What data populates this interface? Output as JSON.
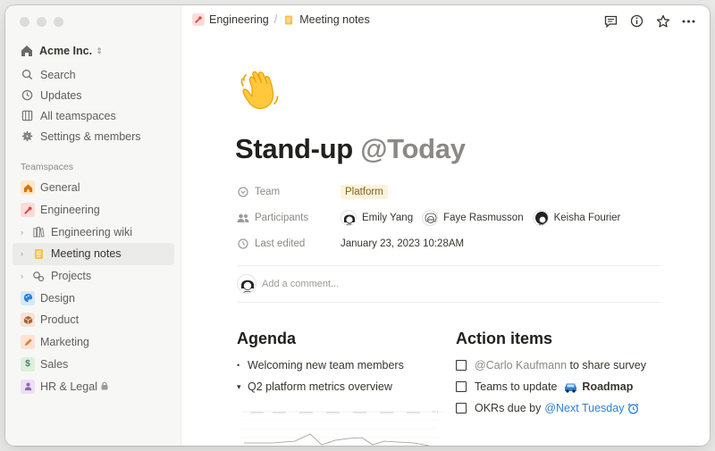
{
  "sidebar": {
    "workspace": "Acme Inc.",
    "workspace_chevron": "⌃⌄",
    "nav": [
      {
        "label": "Search",
        "icon": "search-icon"
      },
      {
        "label": "Updates",
        "icon": "clock-icon"
      },
      {
        "label": "All teamspaces",
        "icon": "grid-icon"
      },
      {
        "label": "Settings & members",
        "icon": "gear-icon"
      }
    ],
    "section_label": "Teamspaces",
    "teamspaces": [
      {
        "label": "General",
        "icon": "house-icon",
        "badge": "#fde8c8"
      },
      {
        "label": "Engineering",
        "icon": "wrench-icon",
        "badge": "#fbdcd9"
      },
      {
        "label": "Engineering wiki",
        "icon": "books-icon",
        "sub": true
      },
      {
        "label": "Meeting notes",
        "icon": "notepad-icon",
        "sub": true,
        "active": true
      },
      {
        "label": "Projects",
        "icon": "gears-icon",
        "sub": true
      },
      {
        "label": "Design",
        "icon": "palette-icon",
        "badge": "#d7e8f7"
      },
      {
        "label": "Product",
        "icon": "box-icon",
        "badge": "#f4e3d6"
      },
      {
        "label": "Marketing",
        "icon": "pen-icon",
        "badge": "#fde3d3"
      },
      {
        "label": "Sales",
        "icon": "dollar-icon",
        "badge": "#dcefdc"
      },
      {
        "label": "HR & Legal",
        "icon": "person-icon",
        "badge": "#ecdff3",
        "locked": true
      }
    ]
  },
  "topbar": {
    "breadcrumb": [
      "Engineering",
      "Meeting notes"
    ],
    "separator": "/"
  },
  "page": {
    "title": "Stand-up",
    "title_mention": "@Today",
    "props": {
      "team_label": "Team",
      "team_value": "Platform",
      "participants_label": "Participants",
      "participants": [
        "Emily Yang",
        "Faye Rasmusson",
        "Keisha Fourier"
      ],
      "edited_label": "Last edited",
      "edited_value": "January 23, 2023 10:28AM"
    },
    "comment_placeholder": "Add a comment...",
    "agenda": {
      "heading": "Agenda",
      "items": [
        "Welcoming new team members",
        "Q2 platform metrics overview"
      ],
      "markers": [
        "•",
        "▾"
      ]
    },
    "actions": {
      "heading": "Action items",
      "todo1_mention": "@Carlo Kaufmann",
      "todo1_text": " to share survey",
      "todo2_text": "Teams to update",
      "todo2_link": "Roadmap",
      "todo3_text": "OKRs due by",
      "todo3_mention": "@Next Tuesday"
    }
  },
  "colors": {
    "accent_blue": "#2e7fd6",
    "tag_bg": "#fbf3db",
    "tag_fg": "#85611e"
  }
}
